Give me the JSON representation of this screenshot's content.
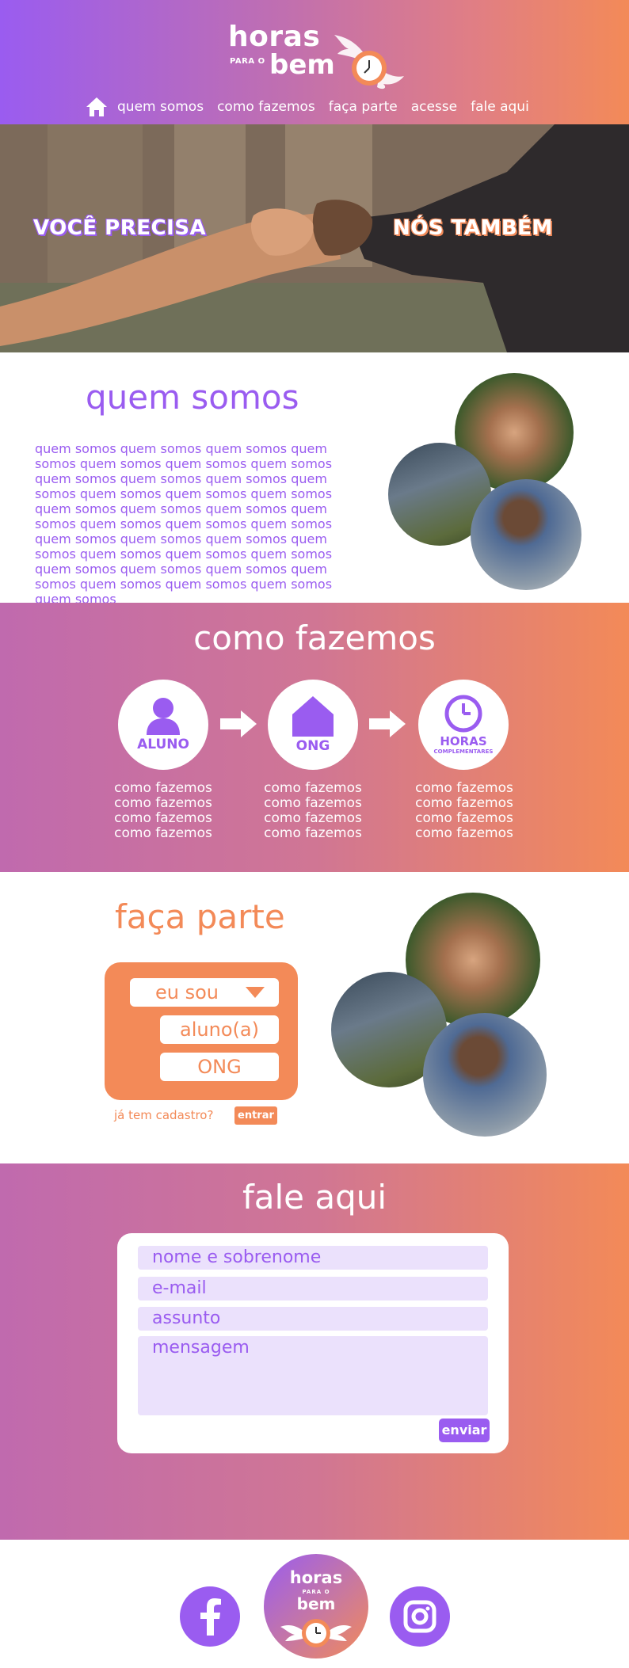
{
  "brand": {
    "logo_horas": "horas",
    "logo_para": "PARA O",
    "logo_bem": "bem"
  },
  "nav": {
    "items": [
      {
        "label": "quem somos"
      },
      {
        "label": "como fazemos"
      },
      {
        "label": "faça parte"
      },
      {
        "label": "acesse"
      },
      {
        "label": "fale aqui"
      }
    ],
    "home_icon": "home-icon"
  },
  "hero": {
    "left_text": "VOCÊ PRECISA",
    "right_text": "NÓS TAMBÉM"
  },
  "quem_somos": {
    "title": "quem somos",
    "body": "quem somos quem somos quem somos quem somos quem somos quem somos quem somos quem somos quem somos quem somos quem somos quem somos quem somos quem somos quem somos quem somos quem somos quem somos quem somos quem somos quem somos quem somos quem somos quem somos quem somos quem somos quem somos quem somos quem somos quem somos quem somos quem somos quem somos quem somos quem somos quem somos"
  },
  "como_fazemos": {
    "title": "como fazemos",
    "steps": [
      {
        "label": "ALUNO",
        "sub": "",
        "icon": "user-icon",
        "text": [
          "como fazemos",
          "como fazemos",
          "como fazemos",
          "como fazemos"
        ]
      },
      {
        "label": "ONG",
        "sub": "",
        "icon": "house-icon",
        "text": [
          "como fazemos",
          "como fazemos",
          "como fazemos",
          "como fazemos"
        ]
      },
      {
        "label": "HORAS",
        "sub": "COMPLEMENTARES",
        "icon": "clock-icon",
        "text": [
          "como fazemos",
          "como fazemos",
          "como fazemos",
          "como fazemos"
        ]
      }
    ]
  },
  "faca_parte": {
    "title": "faça parte",
    "select_label": "eu sou",
    "options": [
      "aluno(a)",
      "ONG"
    ],
    "cadastro_text": "já tem cadastro?",
    "entrar_label": "entrar"
  },
  "fale_aqui": {
    "title": "fale aqui",
    "fields": {
      "name_placeholder": "nome e sobrenome",
      "email_placeholder": "e-mail",
      "subject_placeholder": "assunto",
      "message_placeholder": "mensagem"
    },
    "submit_label": "enviar"
  },
  "footer": {
    "logo_horas": "horas",
    "logo_para": "PARA O",
    "logo_bem": "bem",
    "social": [
      "facebook-icon",
      "instagram-icon"
    ]
  },
  "colors": {
    "purple": "#9a5cf0",
    "orange": "#f38a58",
    "field_bg": "#ebe1fc"
  }
}
